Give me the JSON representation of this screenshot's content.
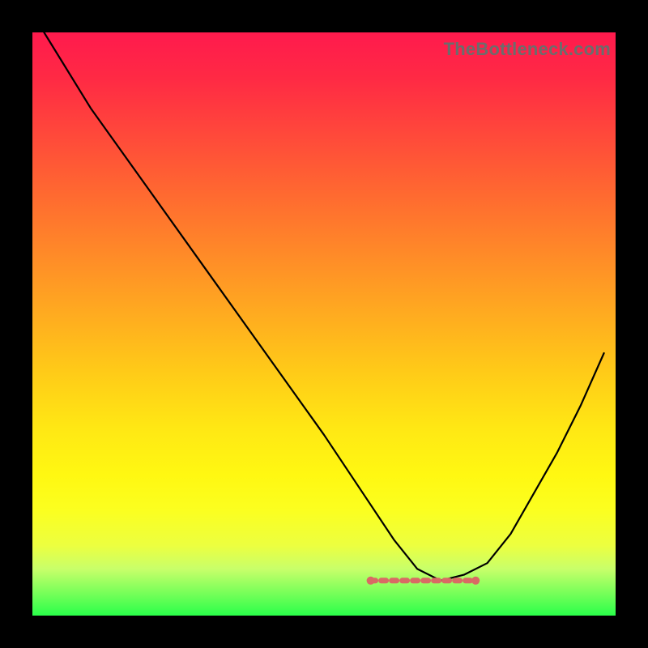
{
  "watermark": "TheBottleneck.com",
  "colors": {
    "background": "#000000",
    "curve": "#000000",
    "valley_accent": "#d96a64",
    "gradient_top": "#ff1a4d",
    "gradient_bottom": "#2aff4a"
  },
  "chart_data": {
    "type": "line",
    "title": "",
    "xlabel": "",
    "ylabel": "",
    "xlim": [
      0,
      100
    ],
    "ylim": [
      0,
      100
    ],
    "grid": false,
    "legend": false,
    "note": "Axes are unlabeled in the image; x/y are normalized 0–100. Curve is a V-shape with minimum near x≈68–72 at y≈6, rising to y≈100 at x≈2 and y≈45 at x≈98.",
    "series": [
      {
        "name": "curve",
        "x": [
          2,
          10,
          20,
          30,
          40,
          50,
          58,
          62,
          66,
          70,
          74,
          78,
          82,
          86,
          90,
          94,
          98
        ],
        "y": [
          100,
          87,
          73,
          59,
          45,
          31,
          19,
          13,
          8,
          6,
          7,
          9,
          14,
          21,
          28,
          36,
          45
        ]
      }
    ],
    "valley_overlay": {
      "x_start": 58,
      "x_end": 76,
      "y": 6
    }
  }
}
